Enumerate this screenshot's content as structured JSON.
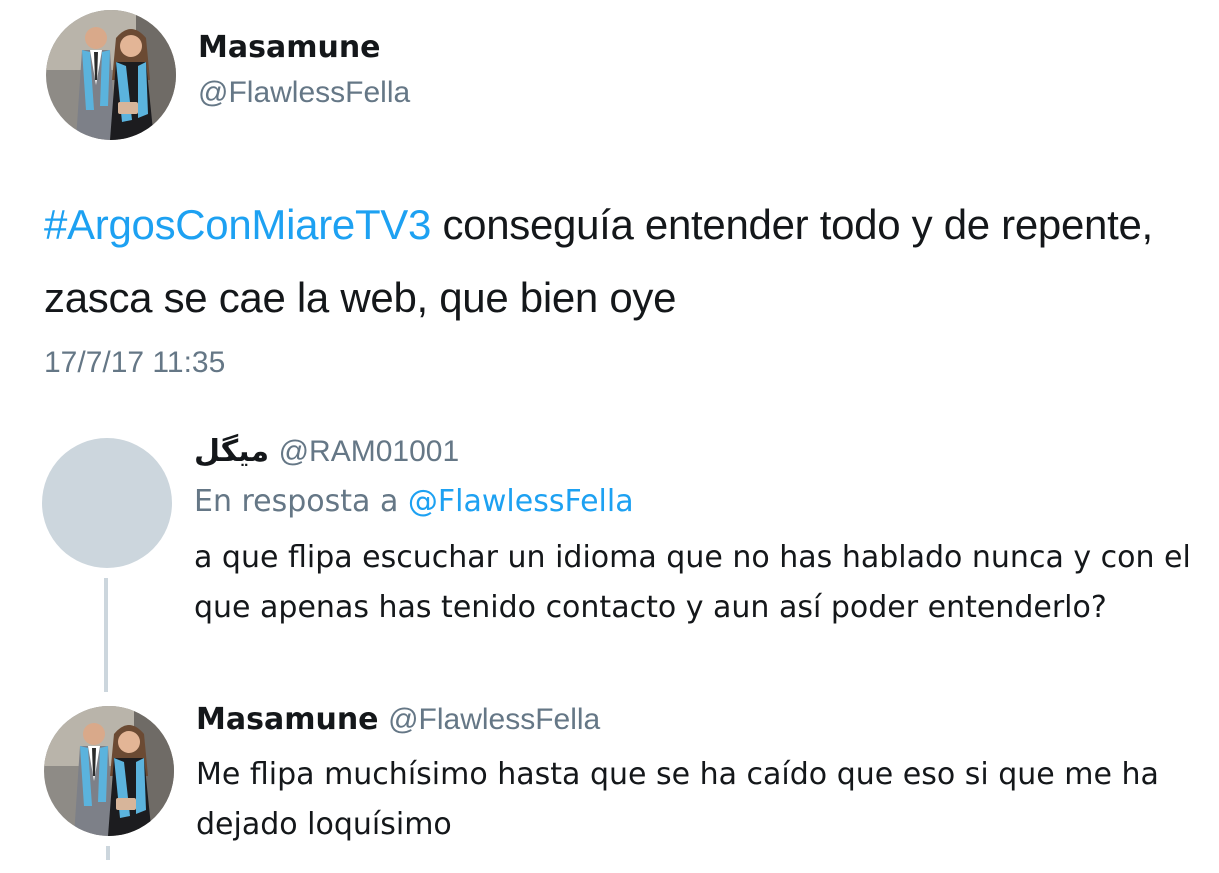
{
  "tweet": {
    "author": {
      "display_name": "Masamune",
      "handle": "@FlawlessFella"
    },
    "hashtag": "#ArgosConMiareTV3",
    "text_after_hashtag": " conseguía entender todo y de repente, zasca se cae la web, que bien oye",
    "timestamp": "17/7/17 11:35"
  },
  "replies": [
    {
      "author": {
        "display_name": "ميگل",
        "handle": "@RAM01001"
      },
      "in_reply_to_prefix": "En resposta a ",
      "in_reply_to_handle": "@FlawlessFella",
      "text": "a que flipa escuchar un idioma que no has hablado nunca y con el que apenas has tenido contacto y aun así poder entenderlo?"
    },
    {
      "author": {
        "display_name": "Masamune",
        "handle": "@FlawlessFella"
      },
      "text": "Me flipa muchísimo hasta que se ha caído que eso si que me ha dejado loquísimo"
    }
  ],
  "colors": {
    "link": "#1da1f2",
    "secondary_text": "#657786",
    "primary_text": "#14171a",
    "default_avatar": "#ccd6dd",
    "thread_line": "#ccd6dd"
  }
}
